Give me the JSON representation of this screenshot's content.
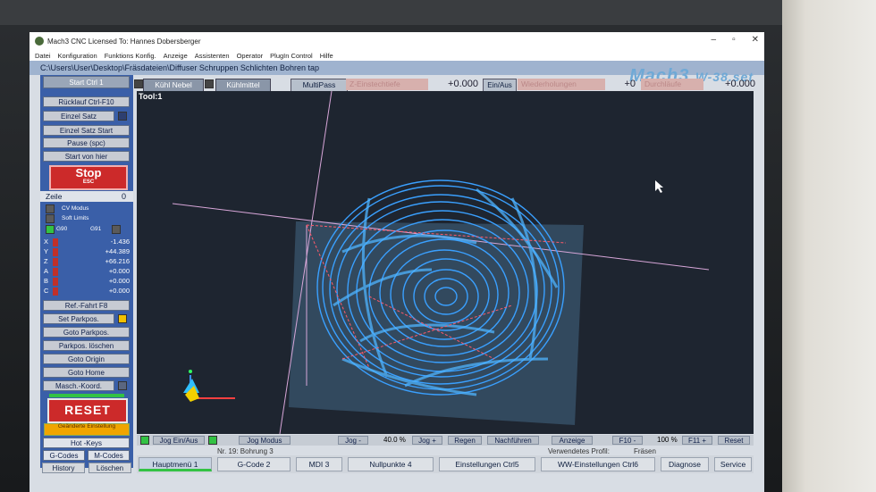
{
  "window": {
    "title": "Mach3 CNC  Licensed To: Hannes Dobersberger"
  },
  "menu": [
    "Datei",
    "Konfiguration",
    "Funktions Konfig.",
    "Anzeige",
    "Assistenten",
    "Operator",
    "PlugIn Control",
    "Hilfe"
  ],
  "file_path": "C:\\Users\\User\\Desktop\\Fräsdateien\\Diffuser Schruppen Schlichten Bohren tap",
  "logo": {
    "main": "Mach3",
    "sub": "W-38.set"
  },
  "top_controls": {
    "kuehl_nebel": "Kühl Nebel",
    "kuehlmittel": "Kühlmittel",
    "multipass": "MultiPass",
    "z_einstech": "Z-Einstechtiefe",
    "value1": "+0.000",
    "ein_aus": "Ein/Aus",
    "wiederholungen": "Wiederholungen",
    "count": "+0",
    "durchlaeufe": "Durchläufe",
    "value2": "+0.000"
  },
  "left_panel": {
    "start": "Start Ctrl 1",
    "ruecklauf": "Rücklauf Ctrl-F10",
    "einzel_satz": "Einzel Satz",
    "einzel_satz_start": "Einzel Satz Start",
    "pause": "Pause (spc)",
    "start_von_hier": "Start von hier",
    "stop": "Stop",
    "stop_sub": "ESC",
    "zeile_label": "Zeile",
    "zeile_value": "0",
    "cv_modus": "CV Modus",
    "soft_limits": "Soft Limits",
    "g90": "G90",
    "g91": "G91",
    "axes": [
      {
        "axis": "X",
        "value": "-1.436"
      },
      {
        "axis": "Y",
        "value": "+44.389"
      },
      {
        "axis": "Z",
        "value": "+66.216"
      },
      {
        "axis": "A",
        "value": "+0.000"
      },
      {
        "axis": "B",
        "value": "+0.000"
      },
      {
        "axis": "C",
        "value": "+0.000"
      }
    ],
    "ref_fahrt": "Ref.-Fahrt F8",
    "set_parkpos": "Set Parkpos.",
    "goto_parkpos": "Goto Parkpos.",
    "parkpos_loeschen": "Parkpos. löschen",
    "goto_origin": "Goto Origin",
    "goto_home": "Goto Home",
    "masch_koord": "Masch.-Koord.",
    "reset": "RESET",
    "geaenderte": "Geänderte Einstellung",
    "hot_keys": "Hot -Keys",
    "g_codes": "G-Codes",
    "m_codes": "M-Codes",
    "history": "History",
    "loeschen": "Löschen"
  },
  "viewport": {
    "tool": "Tool:1"
  },
  "bottom_bar": {
    "jog_ein_aus": "Jog Ein/Aus",
    "jog_modus": "Jog Modus",
    "jog_minus": "Jog -",
    "percent": "40.0 %",
    "jog_plus": "Jog +",
    "regen": "Regen",
    "nachfuehren": "Nachführen",
    "anzeige": "Anzeige",
    "f10_minus": "F10 -",
    "feed_percent": "100 %",
    "f11_plus": "F11 +",
    "reset": "Reset"
  },
  "status": {
    "line": "Nr. 19: Bohrung 3",
    "profil_label": "Verwendetes Profil:",
    "profil_value": "Fräsen"
  },
  "tabs": [
    "Hauptmenü 1",
    "G-Code 2",
    "MDI 3",
    "Nullpunkte 4",
    "Einstellungen Ctrl5",
    "WW-Einstellungen Ctrl6",
    "Diagnose",
    "Service"
  ],
  "colors": {
    "panel_blue": "#3a5fa8",
    "toolpath": "#3aa0ff",
    "stop_red": "#cc2a2a"
  }
}
